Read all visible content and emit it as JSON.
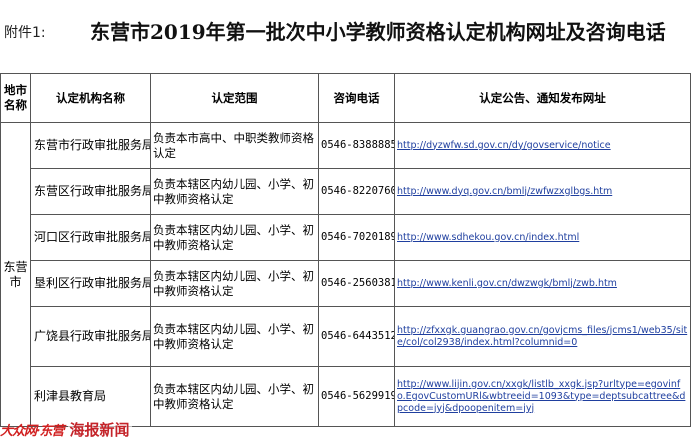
{
  "header": {
    "attachment": "附件1:",
    "title": "东营市2019年第一批次中小学教师资格认定机构网址及咨询电话"
  },
  "table": {
    "columns": [
      "地市名称",
      "认定机构名称",
      "认定范围",
      "咨询电话",
      "认定公告、通知发布网址"
    ],
    "city": "东营市",
    "rows": [
      {
        "org": "东营市行政审批服务局",
        "scope": "负责本市高中、中职类教师资格认定",
        "phone": "0546-8388885",
        "url": "http://dyzwfw.sd.gov.cn/dy/govservice/notice"
      },
      {
        "org": "东营区行政审批服务局",
        "scope": "负责本辖区内幼儿园、小学、初中教师资格认定",
        "phone": "0546-8220760",
        "url": "http://www.dyq.gov.cn/bmlj/zwfwzxglbgs.htm"
      },
      {
        "org": "河口区行政审批服务局",
        "scope": "负责本辖区内幼儿园、小学、初中教师资格认定",
        "phone": "0546-7020189",
        "url": "http://www.sdhekou.gov.cn/index.html"
      },
      {
        "org": "垦利区行政审批服务局",
        "scope": "负责本辖区内幼儿园、小学、初中教师资格认定",
        "phone": "0546-2560381",
        "url": "http://www.kenli.gov.cn/dwzwgk/bmlj/zwb.htm"
      },
      {
        "org": "广饶县行政审批服务局",
        "scope": "负责本辖区内幼儿园、小学、初中教师资格认定",
        "phone": "0546-6443512",
        "url": "http://zfxxgk.guangrao.gov.cn/govjcms_files/jcms1/web35/site/col/col2938/index.html?columnid=0"
      },
      {
        "org": "利津县教育局",
        "scope": "负责本辖区内幼儿园、小学、初中教师资格认定",
        "phone": "0546-5629919",
        "url": "http://www.lijin.gov.cn/xxgk/listlb_xxgk.jsp?urltype=egovinfo.EgovCustomURl&wbtreeid=1093&type=deptsubcattree&dpcode=jyj&dpoopenitem=jyj"
      }
    ]
  },
  "watermark": {
    "logo": "大众网·东营",
    "text": "海报新闻"
  }
}
